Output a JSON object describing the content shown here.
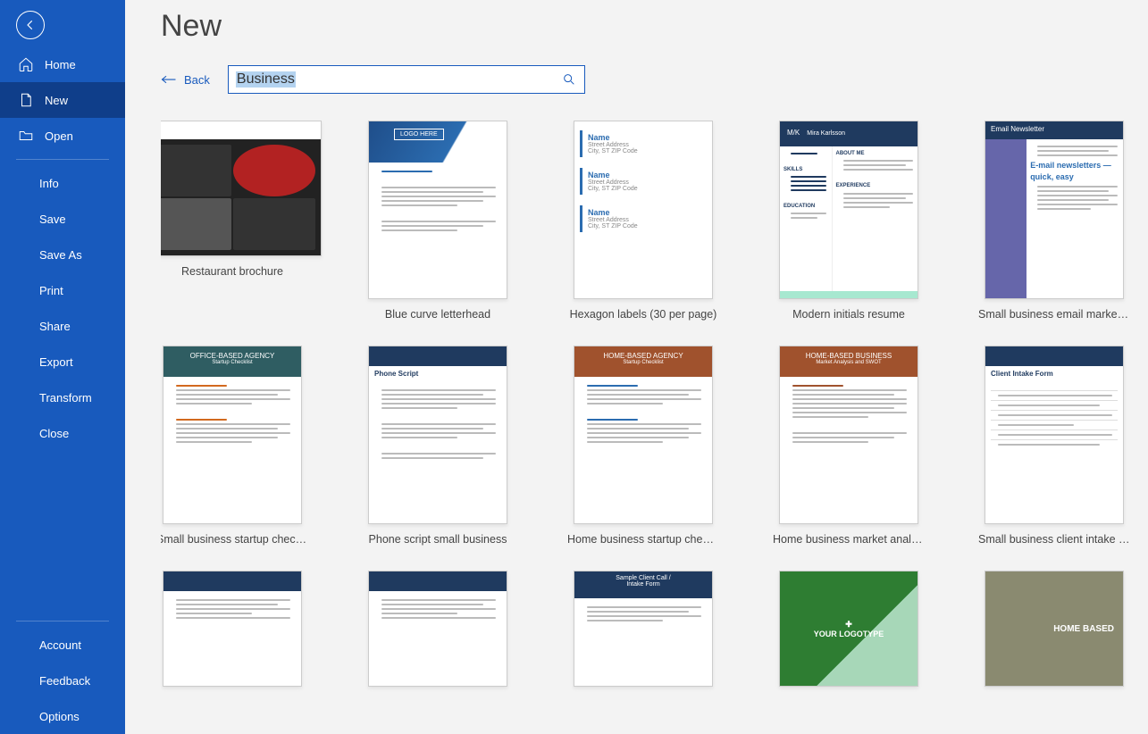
{
  "page": {
    "title": "New"
  },
  "sidebar": {
    "nav": [
      {
        "label": "Home",
        "icon": "home-icon"
      },
      {
        "label": "New",
        "icon": "new-icon",
        "selected": true
      },
      {
        "label": "Open",
        "icon": "open-icon"
      }
    ],
    "sub": [
      "Info",
      "Save",
      "Save As",
      "Print",
      "Share",
      "Export",
      "Transform",
      "Close"
    ],
    "footer": [
      "Account",
      "Feedback",
      "Options"
    ]
  },
  "search": {
    "back_label": "Back",
    "query": "Business"
  },
  "templates": [
    {
      "name": "Restaurant brochure",
      "style": "resto"
    },
    {
      "name": "Blue curve letterhead",
      "style": "bluecurve"
    },
    {
      "name": "Hexagon labels (30 per page)",
      "style": "hexlabels"
    },
    {
      "name": "Modern initials resume",
      "style": "resume"
    },
    {
      "name": "Small business email marketi...",
      "style": "newsletter"
    },
    {
      "name": "Small business startup checklist",
      "style": "teal-checklist"
    },
    {
      "name": "Phone script small business",
      "style": "navy-script"
    },
    {
      "name": "Home business startup check...",
      "style": "brown-checklist"
    },
    {
      "name": "Home business market analy...",
      "style": "brown-market"
    },
    {
      "name": "Small business client intake f...",
      "style": "navy-intake"
    },
    {
      "name": "",
      "style": "navy-form1"
    },
    {
      "name": "",
      "style": "navy-form2"
    },
    {
      "name": "",
      "style": "navy-form3"
    },
    {
      "name": "",
      "style": "green-logo"
    },
    {
      "name": "",
      "style": "homebased-photo"
    }
  ],
  "hex_sample": {
    "name": "Name",
    "addr1": "Street Address",
    "addr2": "City, ST ZIP Code"
  },
  "newsletter_sample": {
    "title": "Email Newsletter",
    "headline": "E-mail newsletters — quick, easy"
  },
  "resume_sample": {
    "initials": "M/K",
    "name": "Mira Karlsson",
    "about": "ABOUT ME",
    "skills": "SKILLS",
    "exp": "EXPERIENCE",
    "edu": "EDUCATION"
  },
  "bluecurve_sample": {
    "logo": "LOGO HERE"
  },
  "teal_sample": {
    "title": "OFFICE-BASED AGENCY",
    "sub": "Startup Checklist"
  },
  "script_sample": {
    "title": "Phone Script"
  },
  "brown1_sample": {
    "title": "HOME-BASED AGENCY",
    "sub": "Startup Checklist"
  },
  "brown2_sample": {
    "title": "HOME-BASED BUSINESS",
    "sub": "Market Analysis and SWOT"
  },
  "intake_sample": {
    "title": "Client Intake Form"
  },
  "green_sample": {
    "logo": "YOUR LOGOTYPE"
  },
  "homebased_sample": {
    "title": "HOME BASED"
  }
}
